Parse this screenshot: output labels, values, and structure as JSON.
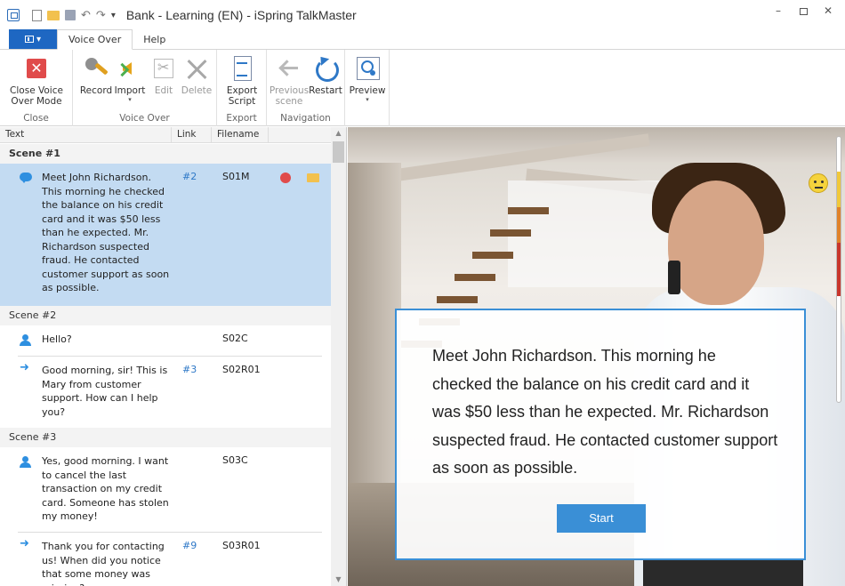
{
  "window": {
    "title": "Bank - Learning (EN) - iSpring TalkMaster",
    "controls": {
      "minimize": "–",
      "close": "✕"
    }
  },
  "qat": {
    "undo": "↶",
    "redo": "↷",
    "more": "▾"
  },
  "tabs": [
    {
      "label": "Voice Over"
    },
    {
      "label": "Help"
    }
  ],
  "ribbon": {
    "close_group": {
      "label": "Close",
      "close_btn": "Close Voice\nOver Mode",
      "close_glyph": "✕"
    },
    "voice_group": {
      "label": "Voice Over",
      "record": "Record",
      "import": "Import",
      "edit": "Edit",
      "delete": "Delete"
    },
    "export_group": {
      "label": "Export",
      "export_script": "Export\nScript"
    },
    "nav_group": {
      "label": "Navigation",
      "previous_scene": "Previous\nscene",
      "restart": "Restart"
    },
    "preview_group": {
      "preview": "Preview"
    },
    "dropdown_arrow": "▾"
  },
  "table": {
    "headers": {
      "text": "Text",
      "link": "Link",
      "filename": "Filename"
    },
    "scenes": [
      {
        "title": "Scene #1"
      },
      {
        "title": "Scene #2"
      },
      {
        "title": "Scene #3"
      }
    ],
    "rows": [
      {
        "text": "Meet John Richardson. This morning he checked the balance on his credit card and it was $50 less than he expected. Mr. Richardson suspected fraud. He contacted customer support as soon as possible.",
        "link": "#2",
        "filename": "S01M",
        "icon": "speech-bubble-icon"
      },
      {
        "text": "Hello?",
        "link": "",
        "filename": "S02C",
        "icon": "person-icon"
      },
      {
        "text": "Good morning, sir! This is Mary from customer support. How can I help you?",
        "link": "#3",
        "filename": "S02R01",
        "icon": "reply-arrow-icon"
      },
      {
        "text": "Yes, good morning. I want to cancel the last transaction on my credit card. Someone has stolen my money!",
        "link": "",
        "filename": "S03C",
        "icon": "person-icon"
      },
      {
        "text": "Thank you for contacting us! When did you notice that some money was missing?",
        "link": "#9",
        "filename": "S03R01",
        "icon": "reply-arrow-icon"
      }
    ]
  },
  "scroll": {
    "up": "▲",
    "down": "▼"
  },
  "preview": {
    "message": "Meet John Richardson. This morning he checked the balance on his credit card and it was $50 less than he expected. Mr. Richardson suspected fraud. He contacted customer support as soon as possible.",
    "start_button": "Start"
  }
}
